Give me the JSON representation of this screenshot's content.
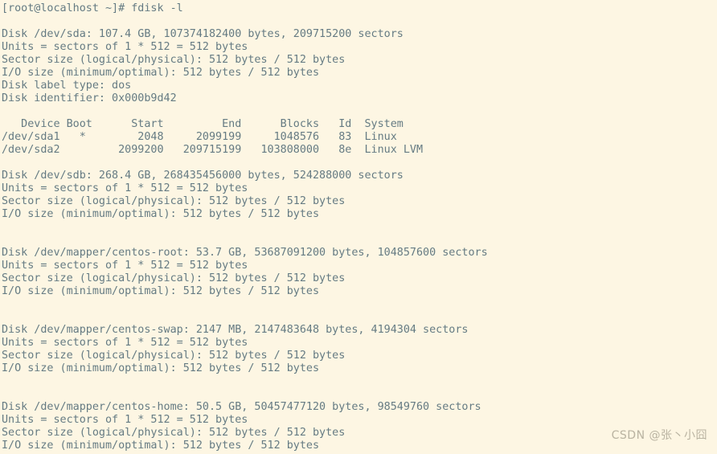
{
  "terminal": {
    "colors": {
      "background": "#fdf6e3",
      "foreground": "#657b83",
      "watermark": "#b9b3a1"
    },
    "prompt": "[root@localhost ~]# fdisk -l",
    "lines": [
      "[root@localhost ~]# fdisk -l",
      "",
      "Disk /dev/sda: 107.4 GB, 107374182400 bytes, 209715200 sectors",
      "Units = sectors of 1 * 512 = 512 bytes",
      "Sector size (logical/physical): 512 bytes / 512 bytes",
      "I/O size (minimum/optimal): 512 bytes / 512 bytes",
      "Disk label type: dos",
      "Disk identifier: 0x000b9d42",
      "",
      "   Device Boot      Start         End      Blocks   Id  System",
      "/dev/sda1   *        2048     2099199     1048576   83  Linux",
      "/dev/sda2         2099200   209715199   103808000   8e  Linux LVM",
      "",
      "Disk /dev/sdb: 268.4 GB, 268435456000 bytes, 524288000 sectors",
      "Units = sectors of 1 * 512 = 512 bytes",
      "Sector size (logical/physical): 512 bytes / 512 bytes",
      "I/O size (minimum/optimal): 512 bytes / 512 bytes",
      "",
      "",
      "Disk /dev/mapper/centos-root: 53.7 GB, 53687091200 bytes, 104857600 sectors",
      "Units = sectors of 1 * 512 = 512 bytes",
      "Sector size (logical/physical): 512 bytes / 512 bytes",
      "I/O size (minimum/optimal): 512 bytes / 512 bytes",
      "",
      "",
      "Disk /dev/mapper/centos-swap: 2147 MB, 2147483648 bytes, 4194304 sectors",
      "Units = sectors of 1 * 512 = 512 bytes",
      "Sector size (logical/physical): 512 bytes / 512 bytes",
      "I/O size (minimum/optimal): 512 bytes / 512 bytes",
      "",
      "",
      "Disk /dev/mapper/centos-home: 50.5 GB, 50457477120 bytes, 98549760 sectors",
      "Units = sectors of 1 * 512 = 512 bytes",
      "Sector size (logical/physical): 512 bytes / 512 bytes",
      "I/O size (minimum/optimal): 512 bytes / 512 bytes"
    ],
    "disks": [
      {
        "device": "/dev/sda",
        "size_human": "107.4 GB",
        "size_bytes": "107374182400",
        "sectors": "209715200",
        "units": "sectors of 1 * 512 = 512 bytes",
        "sector_size": "512 bytes / 512 bytes",
        "io_size": "512 bytes / 512 bytes",
        "label_type": "dos",
        "identifier": "0x000b9d42",
        "partition_table": {
          "headers": [
            "Device",
            "Boot",
            "Start",
            "End",
            "Blocks",
            "Id",
            "System"
          ],
          "rows": [
            {
              "device": "/dev/sda1",
              "boot": "*",
              "start": "2048",
              "end": "2099199",
              "blocks": "1048576",
              "id": "83",
              "system": "Linux"
            },
            {
              "device": "/dev/sda2",
              "boot": "",
              "start": "2099200",
              "end": "209715199",
              "blocks": "103808000",
              "id": "8e",
              "system": "Linux LVM"
            }
          ]
        }
      },
      {
        "device": "/dev/sdb",
        "size_human": "268.4 GB",
        "size_bytes": "268435456000",
        "sectors": "524288000",
        "units": "sectors of 1 * 512 = 512 bytes",
        "sector_size": "512 bytes / 512 bytes",
        "io_size": "512 bytes / 512 bytes"
      },
      {
        "device": "/dev/mapper/centos-root",
        "size_human": "53.7 GB",
        "size_bytes": "53687091200",
        "sectors": "104857600",
        "units": "sectors of 1 * 512 = 512 bytes",
        "sector_size": "512 bytes / 512 bytes",
        "io_size": "512 bytes / 512 bytes"
      },
      {
        "device": "/dev/mapper/centos-swap",
        "size_human": "2147 MB",
        "size_bytes": "2147483648",
        "sectors": "4194304",
        "units": "sectors of 1 * 512 = 512 bytes",
        "sector_size": "512 bytes / 512 bytes",
        "io_size": "512 bytes / 512 bytes"
      },
      {
        "device": "/dev/mapper/centos-home",
        "size_human": "50.5 GB",
        "size_bytes": "50457477120",
        "sectors": "98549760",
        "units": "sectors of 1 * 512 = 512 bytes",
        "sector_size": "512 bytes / 512 bytes",
        "io_size": "512 bytes / 512 bytes"
      }
    ]
  },
  "watermark": {
    "text": "CSDN @张丶小囧"
  }
}
